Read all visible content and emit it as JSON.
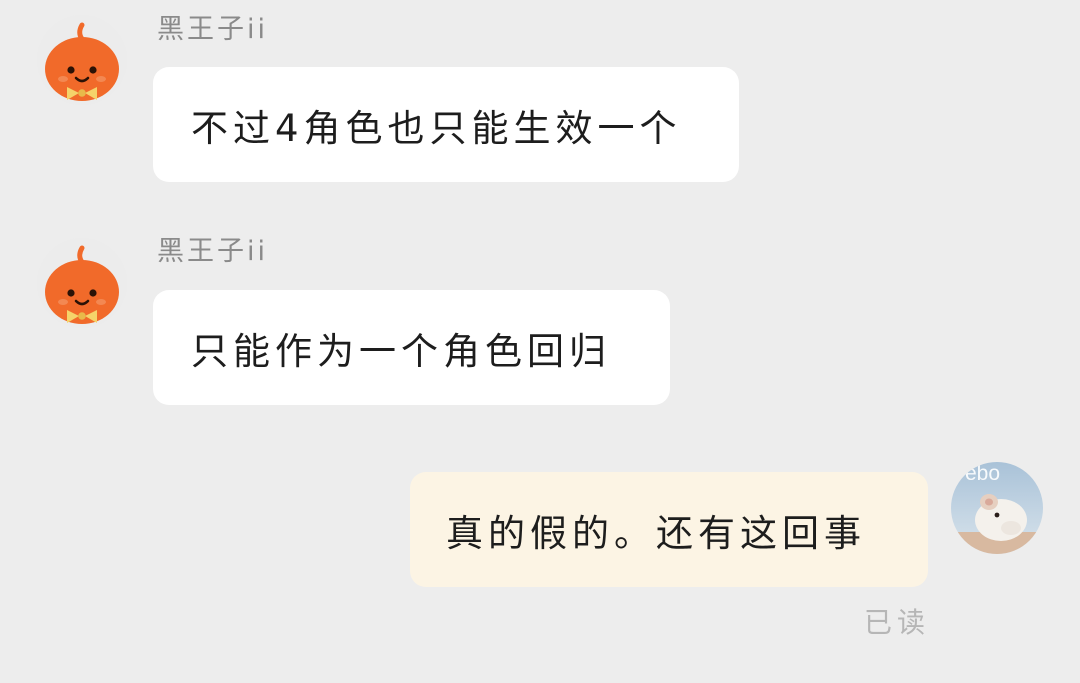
{
  "messages": [
    {
      "direction": "incoming",
      "sender": "黑王子ii",
      "avatar_icon": "orange-mascot-avatar-icon",
      "text": "不过4角色也只能生效一个"
    },
    {
      "direction": "incoming",
      "sender": "黑王子ii",
      "avatar_icon": "orange-mascot-avatar-icon",
      "text": "只能作为一个角色回归"
    },
    {
      "direction": "outgoing",
      "avatar_icon": "hamster-photo-avatar-icon",
      "avatar_overlay_text": "ebo",
      "text": "真的假的。还有这回事",
      "status": "已读"
    }
  ],
  "colors": {
    "background": "#ededed",
    "incoming_bubble": "#ffffff",
    "outgoing_bubble": "#fcf4e4",
    "sender_name": "#8a8a8a",
    "read_status": "#b6b6b6",
    "mascot_orange": "#f16a2a",
    "mascot_bow": "#f5d36a"
  }
}
